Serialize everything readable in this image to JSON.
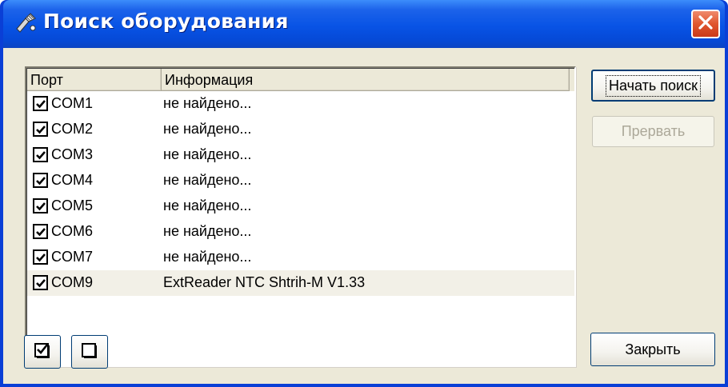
{
  "window": {
    "title": "Поиск оборудования",
    "icon": "scanner-wand-icon",
    "close_icon": "close-x-icon"
  },
  "list": {
    "columns": [
      "Порт",
      "Информация"
    ],
    "rows": [
      {
        "checked": true,
        "port": "COM1",
        "info": "не найдено..."
      },
      {
        "checked": true,
        "port": "COM2",
        "info": "не найдено..."
      },
      {
        "checked": true,
        "port": "COM3",
        "info": "не найдено..."
      },
      {
        "checked": true,
        "port": "COM4",
        "info": "не найдено..."
      },
      {
        "checked": true,
        "port": "COM5",
        "info": "не найдено..."
      },
      {
        "checked": true,
        "port": "COM6",
        "info": "не найдено..."
      },
      {
        "checked": true,
        "port": "COM7",
        "info": "не найдено..."
      },
      {
        "checked": true,
        "port": "COM9",
        "info": "ExtReader NTC Shtrih-M V1.33"
      }
    ]
  },
  "buttons": {
    "start": "Начать поиск",
    "abort": "Прервать",
    "close": "Закрыть",
    "check_all_icon": "checkbox-checked-icon",
    "uncheck_all_icon": "checkbox-empty-icon"
  },
  "colors": {
    "titlebar": "#0853E5",
    "close": "#E0562E",
    "face": "#ECE9D8",
    "disabled_text": "#ACA899"
  }
}
